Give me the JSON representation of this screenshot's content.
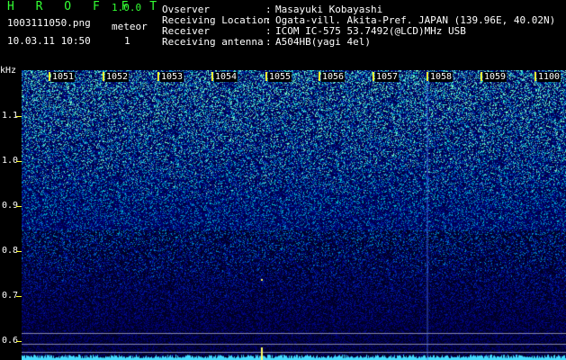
{
  "header": {
    "app_title": "H R O F F T",
    "app_version": "1.0.0",
    "file_name": "1003111050.png",
    "meteor_label": "meteor",
    "timestamp": "10.03.11 10:50",
    "meteor_count": "1",
    "info": [
      {
        "label": "Ovserver",
        "value": "Masayuki Kobayashi"
      },
      {
        "label": "Receiving Location",
        "value": "Ogata-vill. Akita-Pref. JAPAN (139.96E, 40.02N)"
      },
      {
        "label": "Receiver",
        "value": "ICOM IC-575 53.7492(@LCD)MHz USB"
      },
      {
        "label": "Receiving antenna",
        "value": "A504HB(yagi 4el)"
      }
    ]
  },
  "axis": {
    "y_unit": "kHz",
    "y_ticks": [
      "1.1",
      "1.0",
      "0.9",
      "0.8",
      "0.7",
      "0.6"
    ],
    "x_ticks": [
      "1051",
      "1052",
      "1053",
      "1054",
      "1055",
      "1056",
      "1057",
      "1058",
      "1059",
      "1100"
    ]
  },
  "colors": {
    "text": "#ffffff",
    "title": "#33ff33",
    "tick": "#ffff33",
    "background": "#000000"
  }
}
